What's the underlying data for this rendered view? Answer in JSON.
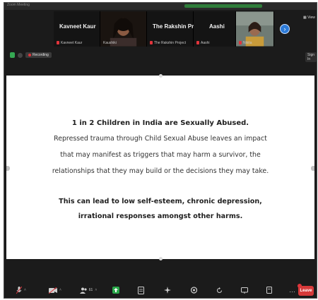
{
  "window": {
    "title": "Zoom Meeting",
    "view_label": "View",
    "sign_in": "Sign In"
  },
  "status": {
    "recording_label": "Recording"
  },
  "participants": [
    {
      "name": "Kavneet Kaur",
      "label": "Kavneet Kaur",
      "muted": true
    },
    {
      "name": "",
      "label": "Kaushiki",
      "muted": false
    },
    {
      "name": "The Rakshin Pro...",
      "label": "The Rakshin Project",
      "muted": true
    },
    {
      "name": "Aashi",
      "label": "Aashi",
      "muted": true
    },
    {
      "name": "",
      "label": "Nikita",
      "muted": false
    }
  ],
  "slide": {
    "headline": "1 in 2 Children in India are Sexually Abused.",
    "body_lines": [
      "Repressed trauma through Child Sexual Abuse leaves an impact",
      "that may manifest as triggers that may harm a survivor, the",
      "relationships that they may build or the decisions they may take."
    ],
    "bold_lines": [
      "This can lead to low self-esteem, chronic depression,",
      "irrational responses amongst other harms."
    ]
  },
  "toolbar": {
    "participants_count": "61",
    "leave_label": "Leave"
  },
  "colors": {
    "accent_blue": "#2d7bd8",
    "leave_red": "#d63a3a",
    "security_green": "#35a853"
  }
}
